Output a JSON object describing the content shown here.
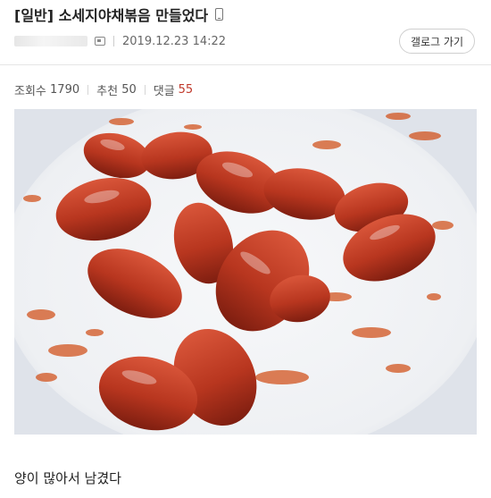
{
  "post": {
    "category": "[일반]",
    "title": "소세지야채볶음 만들었다",
    "date": "2019.12.23 14:22",
    "gallery_button": "갤로그 가기"
  },
  "stats": {
    "views_label": "조회수",
    "views": "1790",
    "likes_label": "추천",
    "likes": "50",
    "comments_label": "댓글",
    "comments": "55"
  },
  "body": {
    "caption": "양이 많아서 남겼다"
  },
  "colors": {
    "comment_count": "#c0392b",
    "sauce": "#b83a1e",
    "plate": "#f3f4f6"
  },
  "icons": [
    "mobile-icon",
    "profile-icon"
  ]
}
